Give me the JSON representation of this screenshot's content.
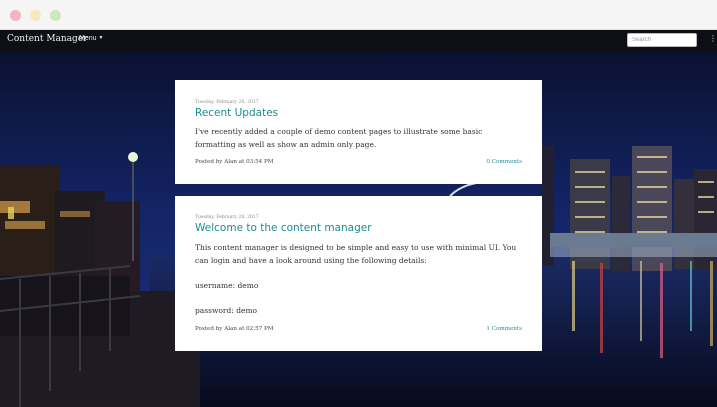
{
  "navbar": {
    "brand": "Content Manager",
    "menu_label": "Menu",
    "search_placeholder": "Search"
  },
  "posts": [
    {
      "date": "Tuesday, February 28, 2017",
      "title": "Recent Updates",
      "paragraphs": [
        "I've recently added a couple of demo content pages to illustrate some basic formatting as well as show an admin only page."
      ],
      "meta": "Posted by Alan at 03:54 PM",
      "comments": "0 Comments"
    },
    {
      "date": "Tuesday, February 28, 2017",
      "title": "Welcome to the content manager",
      "paragraphs": [
        "This content manager is designed to be simple and easy to use with minimal UI. You can login and have a look around using the following details:",
        "username: demo",
        "password: demo"
      ],
      "meta": "Posted by Alan at 02:57 PM",
      "comments": "1 Comments"
    }
  ],
  "colors": {
    "accent": "#1b8c96",
    "navbar": "#0d0f14",
    "sky": "#0e1a4a"
  }
}
